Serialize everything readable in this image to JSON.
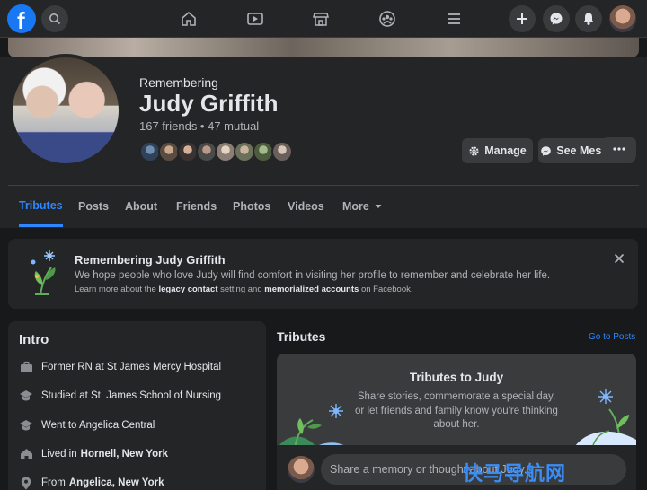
{
  "topbar": {
    "logo_letter": "f",
    "nav": [
      "home-icon",
      "watch-icon",
      "marketplace-icon",
      "groups-icon",
      "menu-icon"
    ],
    "actions": [
      "plus-icon",
      "messenger-icon",
      "notifications-icon"
    ]
  },
  "profile": {
    "status": "Remembering",
    "name": "Judy Griffith",
    "friends_summary": "167 friends • 47 mutual",
    "manage_label": "Manage",
    "messages_label": "See Messages"
  },
  "tabs": [
    {
      "label": "Tributes",
      "active": true
    },
    {
      "label": "Posts"
    },
    {
      "label": "About"
    },
    {
      "label": "Friends"
    },
    {
      "label": "Photos"
    },
    {
      "label": "Videos"
    },
    {
      "label": "More"
    }
  ],
  "banner": {
    "title": "Remembering Judy Griffith",
    "text": "We hope people who love Judy will find comfort in visiting her profile to remember and celebrate her life.",
    "small_prefix": "Learn more about the ",
    "link1": "legacy contact",
    "small_middle": " setting and ",
    "link2": "memorialized accounts",
    "small_suffix": " on Facebook."
  },
  "intro": {
    "title": "Intro",
    "rows": [
      {
        "icon": "briefcase-icon",
        "text": "Former RN at St James Mercy Hospital",
        "bold": ""
      },
      {
        "icon": "graduation-cap-icon",
        "text": "Studied at St. James School of Nursing",
        "bold": ""
      },
      {
        "icon": "graduation-cap-icon",
        "text": "Went to Angelica Central",
        "bold": ""
      },
      {
        "icon": "home-icon",
        "text": "Lived in",
        "bold": "Hornell, New York"
      },
      {
        "icon": "location-pin-icon",
        "text": "From",
        "bold": "Angelica, New York"
      }
    ]
  },
  "tributes": {
    "heading": "Tributes",
    "goto_posts": "Go to Posts",
    "card_title": "Tributes to Judy",
    "card_text": "Share stories, commemorate a special day, or let friends and family know you're thinking about her.",
    "input_placeholder": "Share a memory or thought about Judy..."
  },
  "watermark": "快马导航网",
  "colors": {
    "accent": "#2d88ff",
    "surface": "#242526",
    "background": "#18191a"
  }
}
